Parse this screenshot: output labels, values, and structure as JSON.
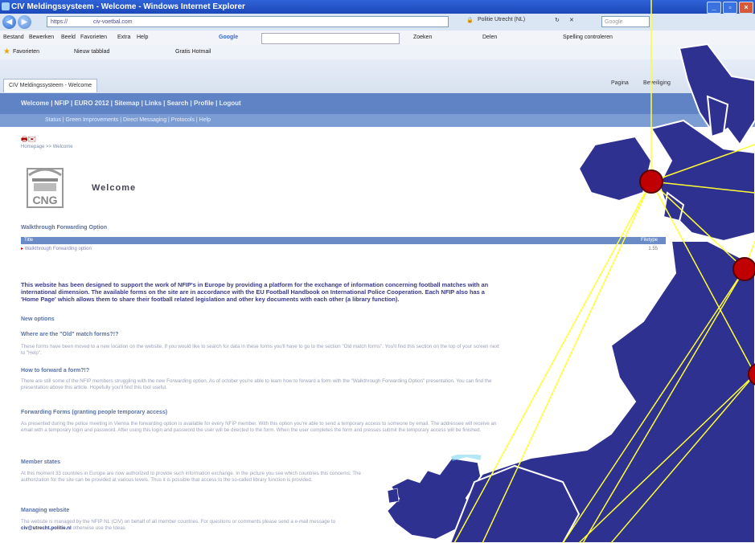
{
  "window": {
    "title": "CIV Meldingssysteem - Welcome - Windows Internet Explorer",
    "buttons": [
      "_",
      "▫",
      "×"
    ]
  },
  "address_bar": {
    "url_prefix": "https://",
    "url_host": "civ-voetbal.com",
    "lock_label": "Politie Utrecht (NL)",
    "search_engine": "Google"
  },
  "menu": {
    "items": [
      "Bestand",
      "Bewerken",
      "Beeld",
      "Favorieten",
      "Extra",
      "Help"
    ],
    "google_label": "Google",
    "toolbar_items": [
      "Zoeken",
      "Delen",
      "Spelling controleren"
    ]
  },
  "favorites_bar": {
    "favorites_label": "Favorieten",
    "items": [
      "Nieuw tabblad",
      "Gratis Hotmail"
    ]
  },
  "tabs": {
    "active_tab": "CIV Meldingssysteem - Welcome",
    "commands": [
      "Pagina",
      "Beveiliging"
    ]
  },
  "site_nav": {
    "main_links": "Welcome | NFIP | EURO 2012 | Sitemap | Links | Search | Profile | Logout",
    "sub_links": "Status | Green Improvements | Direct Messaging | Protocols | Help"
  },
  "page": {
    "breadcrumb": "Homepage >> Welcome",
    "logo_text": "CNG",
    "heading": "Welcome",
    "walkthrough_header": "Walkthrough Forwarding Option",
    "table": {
      "col_title": "Title",
      "col_filetype": "Filetype",
      "row_title": "Walkthrough Forwarding option",
      "row_value": "1.55"
    },
    "intro": "This website has been designed to support the work of NFIP's in Europe by providing a platform for the exchange of information concerning football matches with an international dimension. The available forms on the site are in accordance with the EU Football Handbook on International Police Cooperation. Each NFIP also has a 'Home Page' which allows them to share their football related legislation and other key documents with each other (a library function).",
    "sections": [
      {
        "heading": "New options",
        "text": ""
      },
      {
        "heading": "Where are the \"Old\" match forms?!?",
        "text": "These forms have been moved to a new location on the website. If you would like to search for data in these forms you'll have to go to the section \"Old match forms\". You'll find this section on the top of your screen next to \"Help\"."
      },
      {
        "heading": "How to forward a form?!?",
        "text": "There are still some of the NFIP members struggling with the new Forwarding option. As of october you're able to learn how to forward a form with the \"Walkthrough Forwarding Option\" presentation. You can find the presentation above this article. Hopefully you'll find this tool useful."
      },
      {
        "heading": "Forwarding Forms (granting people temporary access)",
        "text": "As presented during the police meeting in Vienna the forwarding option is available for every NFIP member. With this option you're able to send a temporary access to someone by email. The addressee will receive an email with a temporary login and password. After using this login and password the user will be directed to the form. When the user completes the form and presses submit the temporary access will be finished."
      },
      {
        "heading": "Member states",
        "text": "At this moment 33 countries in Europe are now authorized to provide such information exchange. In the picture you see which countries this concerns. The authorization for the site can be provided at various levels. Thus it is possible that access to the so-called library function is provided."
      },
      {
        "heading": "Managing website",
        "text": "The website is managed by the NFIP NL (CIV) on behalf of all member countries. For questions or comments please send a e-mail message to"
      }
    ],
    "contact_email": "civ@utrecht.politie.nl",
    "contact_suffix": " otherwise use the Ideas"
  },
  "colors": {
    "map_fill": "#2f3191",
    "map_stroke": "#ffffff",
    "connection_lines": "#ffff33",
    "node": "#c00000",
    "site_nav": "#5f83c4"
  }
}
